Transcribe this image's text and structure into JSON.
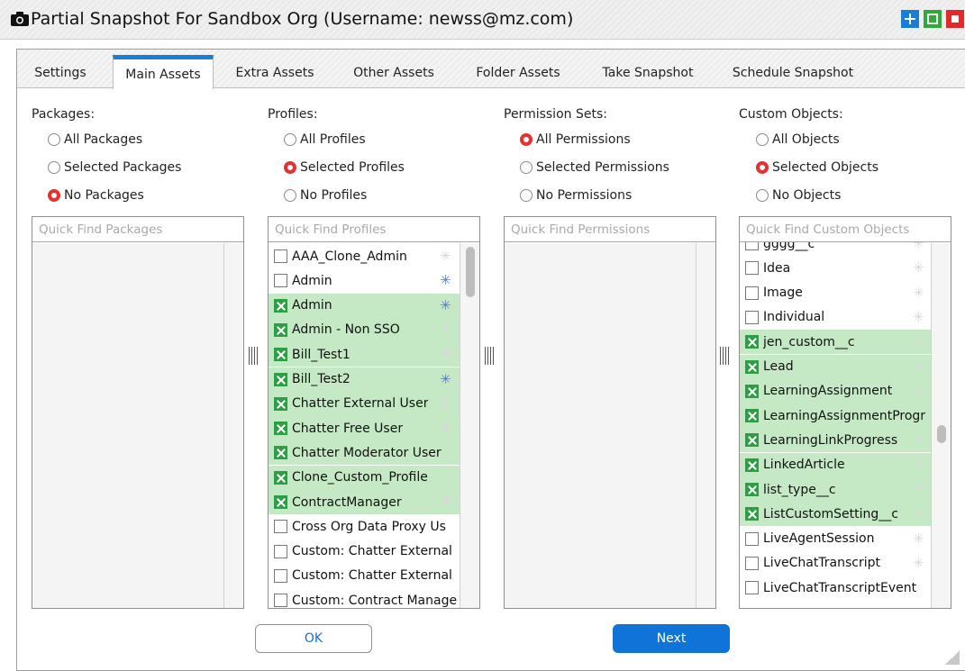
{
  "window": {
    "title": "Partial Snapshot For Sandbox Org (Username: newss@mz.com)",
    "controls": [
      "plus-icon",
      "maximize-icon",
      "close-icon"
    ]
  },
  "tabs": [
    "Settings",
    "Main Assets",
    "Extra Assets",
    "Other Assets",
    "Folder Assets",
    "Take Snapshot",
    "Schedule Snapshot"
  ],
  "active_tab": "Main Assets",
  "packages": {
    "label": "Packages:",
    "options": [
      "All Packages",
      "Selected Packages",
      "No Packages"
    ],
    "selected": "No Packages",
    "search_placeholder": "Quick Find Packages"
  },
  "profiles": {
    "label": "Profiles:",
    "options": [
      "All Profiles",
      "Selected Profiles",
      "No Profiles"
    ],
    "selected": "Selected Profiles",
    "search_placeholder": "Quick Find Profiles",
    "items": [
      {
        "label": "AAA_Clone_Admin",
        "checked": false,
        "star": "light"
      },
      {
        "label": "Admin",
        "checked": false,
        "star": "dark"
      },
      {
        "label": "Admin",
        "checked": true,
        "star": "dark"
      },
      {
        "label": "Admin - Non SSO",
        "checked": true,
        "star": "light"
      },
      {
        "label": "Bill_Test1",
        "checked": true,
        "star": "light"
      },
      {
        "label": "Bill_Test2",
        "checked": true,
        "star": "dark"
      },
      {
        "label": "Chatter External User",
        "checked": true,
        "star": "light"
      },
      {
        "label": "Chatter Free User",
        "checked": true,
        "star": "light"
      },
      {
        "label": "Chatter Moderator User",
        "checked": true,
        "star": "none"
      },
      {
        "label": "Clone_Custom_Profile",
        "checked": true,
        "star": "none"
      },
      {
        "label": "ContractManager",
        "checked": true,
        "star": "light"
      },
      {
        "label": "Cross Org Data Proxy Us",
        "checked": false,
        "star": "none"
      },
      {
        "label": "Custom: Chatter External",
        "checked": false,
        "star": "none"
      },
      {
        "label": "Custom: Chatter External",
        "checked": false,
        "star": "none"
      },
      {
        "label": "Custom: Contract Manage",
        "checked": false,
        "star": "none"
      }
    ]
  },
  "permission_sets": {
    "label": "Permission Sets:",
    "options": [
      "All Permissions",
      "Selected Permissions",
      "No Permissions"
    ],
    "selected": "All Permissions",
    "search_placeholder": "Quick Find Permissions"
  },
  "custom_objects": {
    "label": "Custom Objects:",
    "options": [
      "All Objects",
      "Selected Objects",
      "No Objects"
    ],
    "selected": "Selected Objects",
    "search_placeholder": "Quick Find Custom Objects",
    "items": [
      {
        "label": "gggg__c",
        "checked": false,
        "star": "light"
      },
      {
        "label": "Idea",
        "checked": false,
        "star": "light"
      },
      {
        "label": "Image",
        "checked": false,
        "star": "light"
      },
      {
        "label": "Individual",
        "checked": false,
        "star": "light"
      },
      {
        "label": "jen_custom__c",
        "checked": true,
        "star": "light"
      },
      {
        "label": "Lead",
        "checked": true,
        "star": "light"
      },
      {
        "label": "LearningAssignment",
        "checked": true,
        "star": "light"
      },
      {
        "label": "LearningAssignmentProgr",
        "checked": true,
        "star": "none"
      },
      {
        "label": "LearningLinkProgress",
        "checked": true,
        "star": "light"
      },
      {
        "label": "LinkedArticle",
        "checked": true,
        "star": "light"
      },
      {
        "label": "list_type__c",
        "checked": true,
        "star": "light"
      },
      {
        "label": "ListCustomSetting__c",
        "checked": true,
        "star": "light"
      },
      {
        "label": "LiveAgentSession",
        "checked": false,
        "star": "light"
      },
      {
        "label": "LiveChatTranscript",
        "checked": false,
        "star": "light"
      },
      {
        "label": "LiveChatTranscriptEvent",
        "checked": false,
        "star": "none"
      }
    ]
  },
  "buttons": {
    "ok": "OK",
    "next": "Next"
  },
  "colors": {
    "accent": "#1a7fd4",
    "selected_row": "#c5e9c5",
    "checkbox_on": "#2e9e46",
    "radio_on": "#e43232"
  }
}
